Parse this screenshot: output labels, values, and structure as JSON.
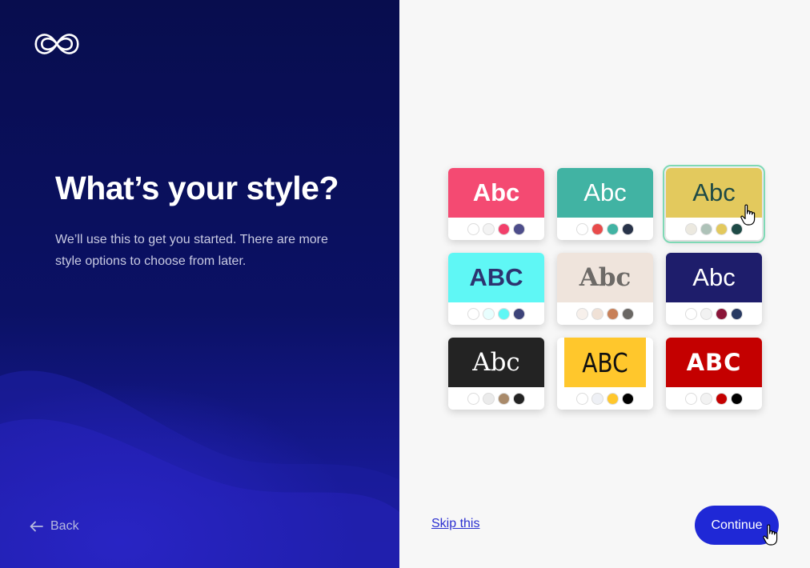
{
  "page": {
    "headline": "What’s your style?",
    "subtext": "We’ll use this to get you started. There are more style options to choose from later.",
    "back_label": "Back",
    "skip_label": "Skip this",
    "continue_label": "Continue"
  },
  "styles": [
    {
      "label": "Abc",
      "bg": "#f44a72",
      "fg": "#ffffff",
      "font": "sans",
      "weight": "bold",
      "dots": [
        "#ffffff",
        "#f3f3f3",
        "#f23f6a",
        "#4d4d8a"
      ]
    },
    {
      "label": "Abc",
      "bg": "#41b3a3",
      "fg": "#ffffff",
      "font": "sans",
      "weight": "normal",
      "dots": [
        "#ffffff",
        "#e84b4b",
        "#41b3a3",
        "#283349"
      ]
    },
    {
      "label": "Abc",
      "bg": "#e3c95d",
      "fg": "#1e4a46",
      "font": "sans",
      "weight": "normal",
      "dots": [
        "#ece9e0",
        "#aec2b8",
        "#e3c95d",
        "#1e4a46"
      ],
      "selected": true
    },
    {
      "label": "ABC",
      "bg": "#5ff7f5",
      "fg": "#2d3470",
      "font": "sans",
      "weight": "bold",
      "dots": [
        "#ffffff",
        "#e8fefe",
        "#5ff7f5",
        "#3d4379"
      ]
    },
    {
      "label": "Abc",
      "bg": "#efe4dc",
      "fg": "#6d6a67",
      "font": "serif",
      "weight": "bold",
      "dots": [
        "#f7f0eb",
        "#f0e1d6",
        "#c88058",
        "#6a6764"
      ]
    },
    {
      "label": "Abc",
      "bg": "#1e1d6b",
      "fg": "#ffffff",
      "font": "sans",
      "weight": "normal",
      "dots": [
        "#ffffff",
        "#f2f2f2",
        "#8a1538",
        "#283a62"
      ]
    },
    {
      "label": "Abc",
      "bg": "#232323",
      "fg": "#ffffff",
      "font": "serif",
      "weight": "normal",
      "dots": [
        "#ffffff",
        "#ebebeb",
        "#a98a6a",
        "#232323"
      ]
    },
    {
      "label": "ABC",
      "bg": "#ffc72c",
      "fg": "#111111",
      "font": "sans-condensed",
      "weight": "normal",
      "dots": [
        "#ffffff",
        "#eef0f5",
        "#ffc72c",
        "#000000"
      ]
    },
    {
      "label": "ABC",
      "bg": "#c40000",
      "fg": "#ffffff",
      "font": "sans-wide",
      "weight": "bold",
      "dots": [
        "#ffffff",
        "#f2f2f2",
        "#c40000",
        "#000000"
      ]
    }
  ],
  "colors": {
    "left_bg": "#080d4e",
    "accent": "#1f28d6",
    "selected_outline": "#7fd9b5"
  },
  "icons": {
    "logo": "infinity-logo-icon",
    "back": "arrow-left-icon",
    "cursor": "hand-pointer-icon"
  }
}
